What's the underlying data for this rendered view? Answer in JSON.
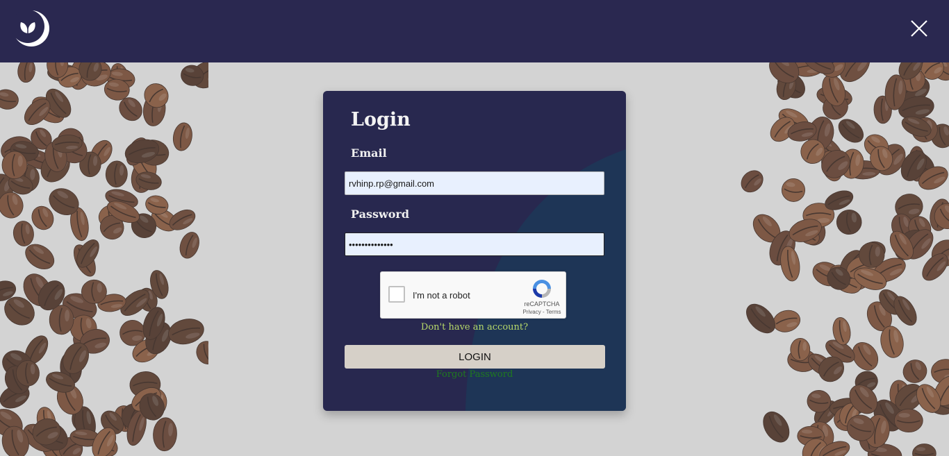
{
  "header": {
    "logo_icon": "leaf-moon-logo",
    "close_icon": "close-icon",
    "background_color": "#2a2850"
  },
  "login": {
    "title": "Login",
    "email_label": "Email",
    "email_value": "rvhinp.rp@gmail.com",
    "password_label": "Password",
    "password_value": "••••••••••••••",
    "captcha": {
      "checkbox_label": "I'm not a robot",
      "brand": "reCAPTCHA",
      "links": "Privacy - Terms"
    },
    "signup_link": "Don't have an account?",
    "login_button": "LOGIN",
    "forgot_link": "Forgot Password"
  },
  "colors": {
    "card": "#28284f",
    "card_swoosh": "#1e3556",
    "signup_link": "#b7d96a",
    "forgot_link": "#1f7a1f",
    "login_button": "#d6d0c8"
  }
}
